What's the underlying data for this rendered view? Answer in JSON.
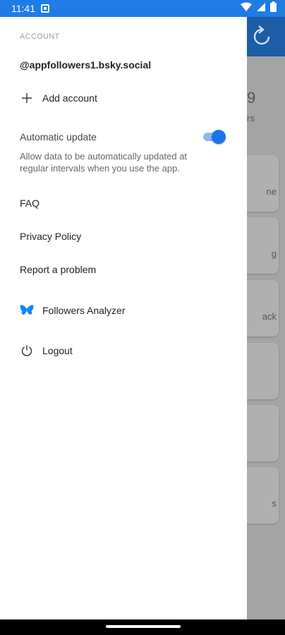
{
  "status_bar": {
    "time": "11:41",
    "icons": [
      "notification-icon",
      "wifi-icon",
      "signal-icon",
      "battery-icon"
    ]
  },
  "drawer": {
    "section_label": "ACCOUNT",
    "account_handle": "@appfollowers1.bsky.social",
    "add_account_label": "Add account",
    "automatic_update": {
      "label": "Automatic update",
      "description": "Allow data to be automatically updated at regular intervals when you use the app.",
      "enabled": true
    },
    "faq_label": "FAQ",
    "privacy_label": "Privacy Policy",
    "report_label": "Report a problem",
    "app_link_label": "Followers Analyzer",
    "logout_label": "Logout"
  },
  "background": {
    "big_number_fragment": "9",
    "subtitle_fragment": "rs",
    "card_fragments": [
      "ne",
      "g",
      "ack",
      "",
      "",
      "s"
    ]
  },
  "colors": {
    "accent": "#1a73e8",
    "status_bar": "#1f7ce6",
    "header": "#1d5ca6",
    "butterfly": "#1185fe"
  }
}
